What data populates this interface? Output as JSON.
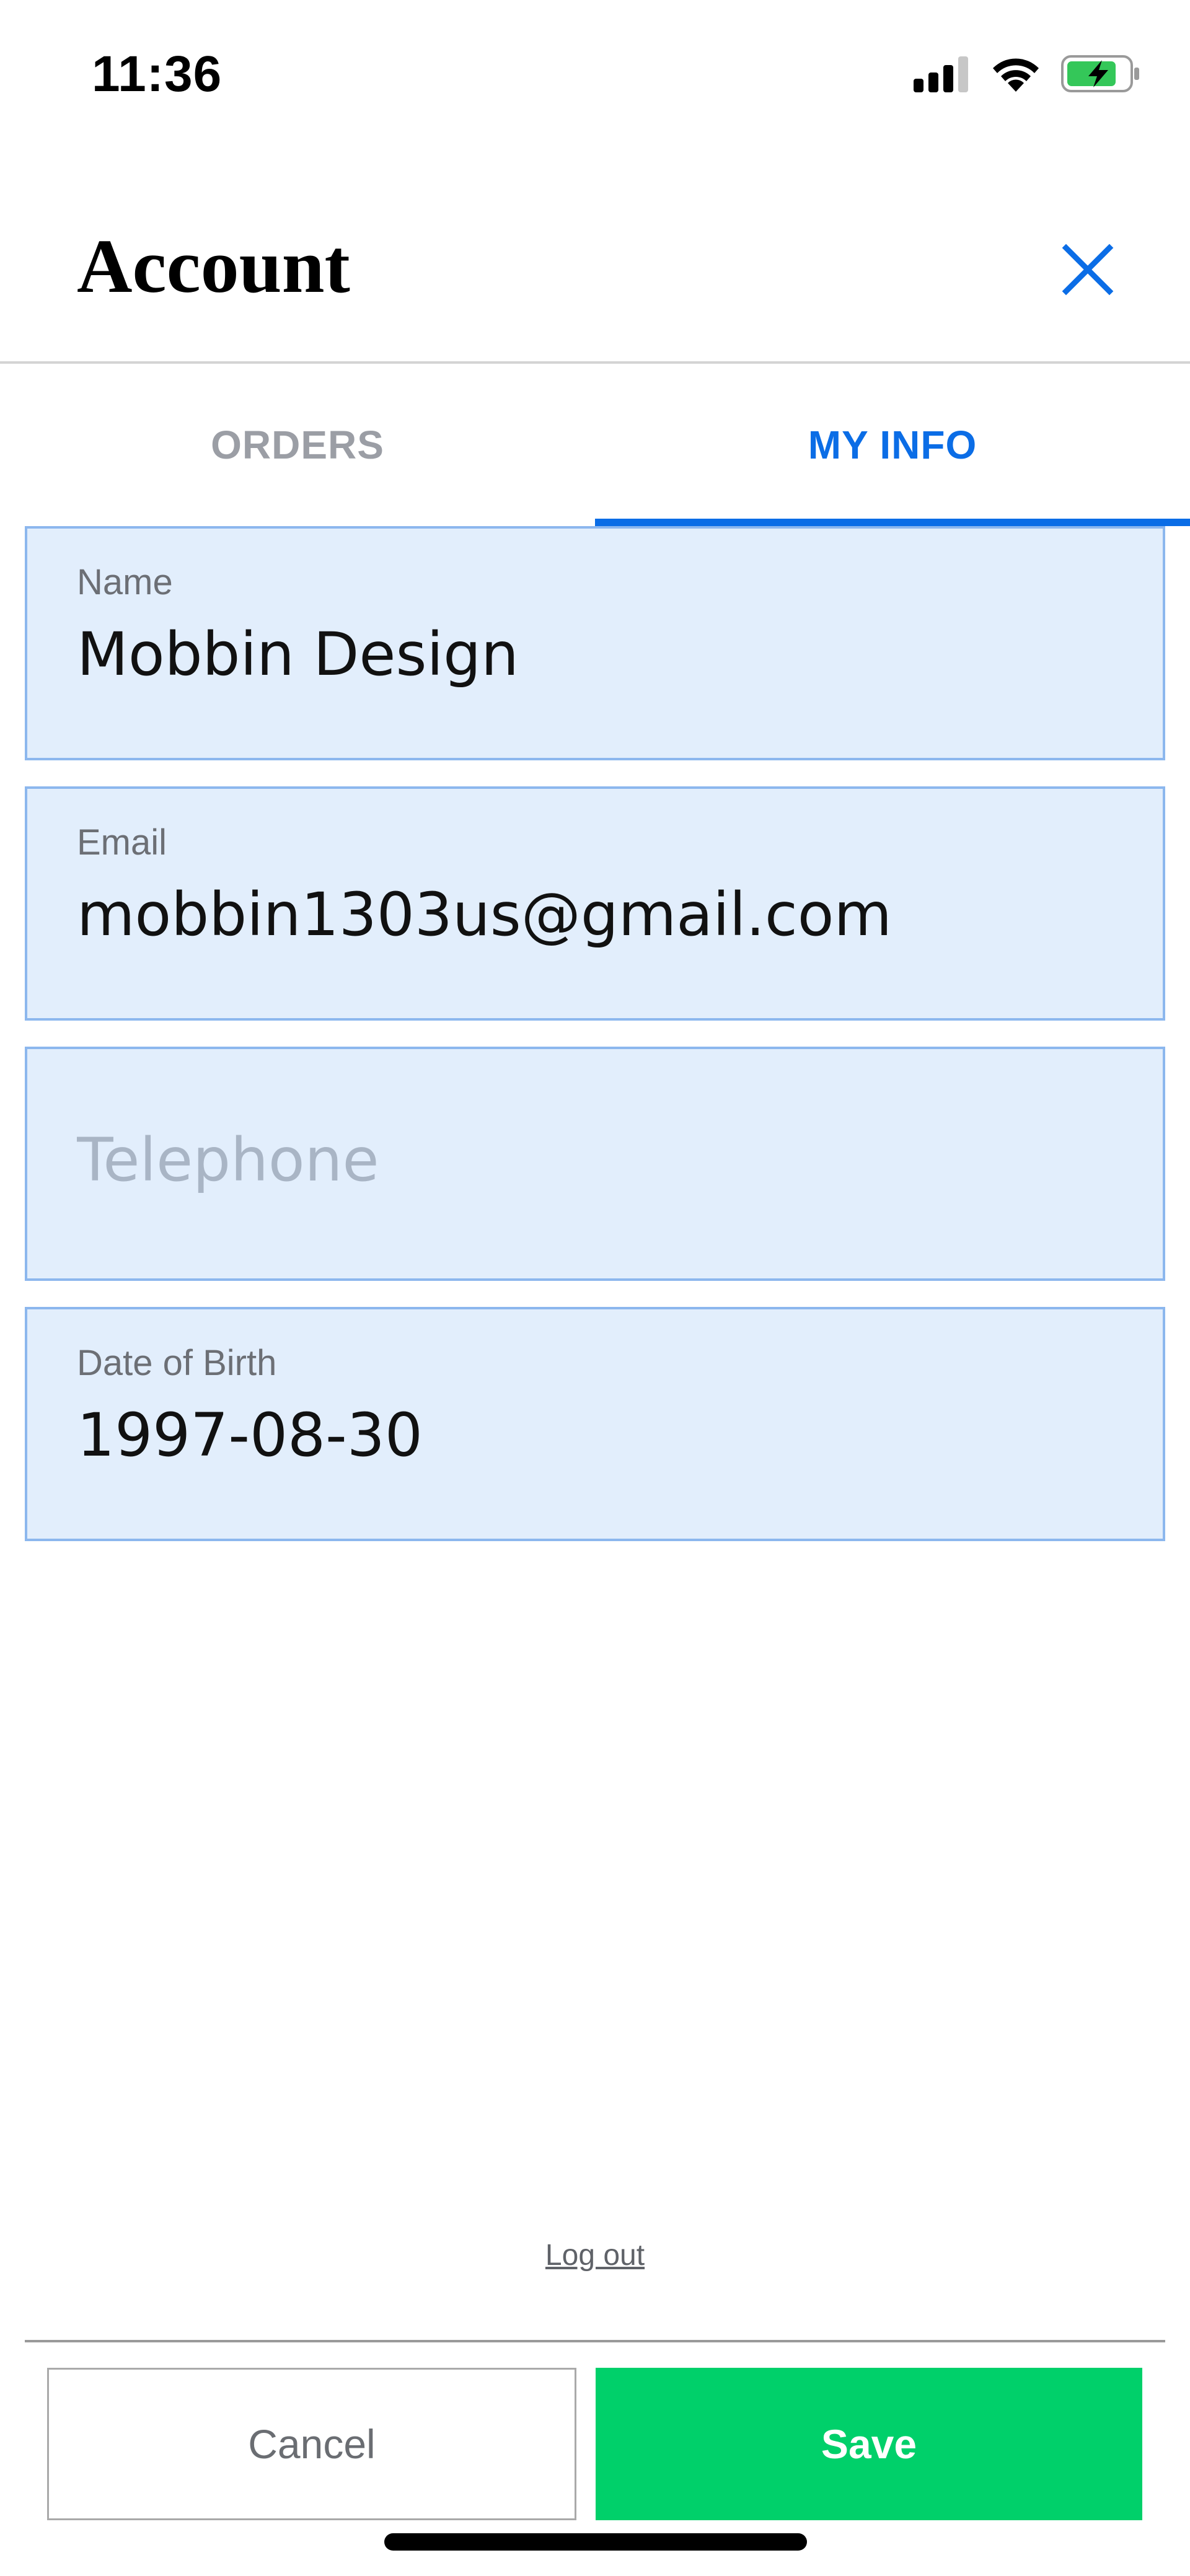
{
  "status_bar": {
    "time": "11:36",
    "icons": [
      "signal-icon",
      "wifi-icon",
      "battery-charging-icon"
    ]
  },
  "header": {
    "title": "Account",
    "close_icon": "close-icon"
  },
  "tabs": [
    {
      "label": "ORDERS",
      "active": false
    },
    {
      "label": "MY INFO",
      "active": true
    }
  ],
  "form": {
    "name": {
      "label": "Name",
      "value": "Mobbin Design"
    },
    "email": {
      "label": "Email",
      "value": "mobbin1303us@gmail.com"
    },
    "telephone": {
      "placeholder": "Telephone",
      "value": ""
    },
    "date_of_birth": {
      "label": "Date of Birth",
      "value": "1997-08-30"
    }
  },
  "logout_label": "Log out",
  "actions": {
    "cancel_label": "Cancel",
    "save_label": "Save"
  },
  "colors": {
    "accent": "#0b6de6",
    "field_background": "#e2eefc",
    "field_border": "#8cb7ee",
    "save_button": "#00d06a",
    "battery_fill": "#34c759"
  }
}
